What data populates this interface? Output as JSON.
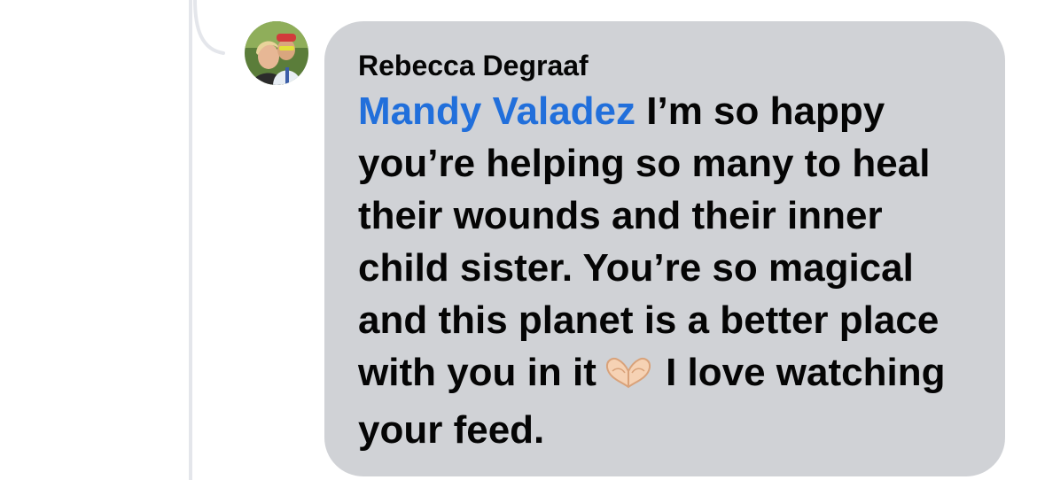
{
  "comment": {
    "author": "Rebecca Degraaf",
    "mention": "Mandy Valadez",
    "text_before_emoji": " I’m so happy you’re helping so many to heal their wounds and their inner child sister. You’re so magical and this planet is a better place with you in it",
    "emoji_icon": "heart-hands-icon",
    "text_after_emoji": " I love watching your feed."
  },
  "colors": {
    "bubble": "#d0d2d6",
    "mention": "#216fdb",
    "text": "#050505",
    "thread_line": "#e4e6eb"
  }
}
